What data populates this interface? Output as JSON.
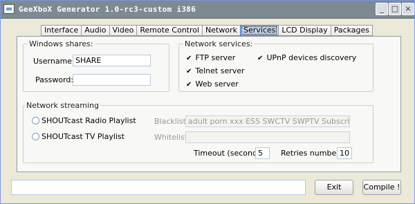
{
  "window": {
    "title": "GeeXboX Generator 1.0-rc3-custom i386",
    "minimize_glyph": "_",
    "maximize_glyph": "□",
    "close_glyph": "×"
  },
  "tabs": [
    {
      "label": "Interface"
    },
    {
      "label": "Audio"
    },
    {
      "label": "Video"
    },
    {
      "label": "Remote Control"
    },
    {
      "label": "Network"
    },
    {
      "label": "Services"
    },
    {
      "label": "LCD Display"
    },
    {
      "label": "Packages"
    }
  ],
  "active_tab": "Services",
  "windows_shares": {
    "title": "Windows shares:",
    "username_label": "Username:",
    "username_value": "SHARE",
    "password_label": "Password:",
    "password_value": ""
  },
  "network_services": {
    "title": "Network services:",
    "checkmark": "✔",
    "ftp": {
      "label": "FTP server",
      "checked": true
    },
    "upnp": {
      "label": "UPnP devices discovery",
      "checked": true
    },
    "telnet": {
      "label": "Telnet server",
      "checked": true
    },
    "web": {
      "label": "Web server",
      "checked": true
    }
  },
  "network_streaming": {
    "title": "Network streaming",
    "radio_playlist": {
      "label": "SHOUTcast Radio Playlist",
      "checked": false
    },
    "tv_playlist": {
      "label": "SHOUTcast TV Playlist",
      "checked": false
    },
    "blacklist_label": "Blacklist:",
    "blacklist_value": "adult porn xxx ESS SWCTV SWPTV Subscription",
    "whitelist_label": "Whitelist:",
    "whitelist_value": "",
    "timeout_label": "Timeout (second):",
    "timeout_value": "5",
    "retries_label": "Retries number:",
    "retries_value": "10"
  },
  "footer": {
    "status_value": "",
    "exit_label": "Exit",
    "compile_label": "Compile !"
  },
  "colors": {
    "titlebar": "#7E8A92",
    "active_tab": "#C1D2EE",
    "window_bg": "#ECE9D8",
    "panel_bg": "#F8F8F6"
  }
}
